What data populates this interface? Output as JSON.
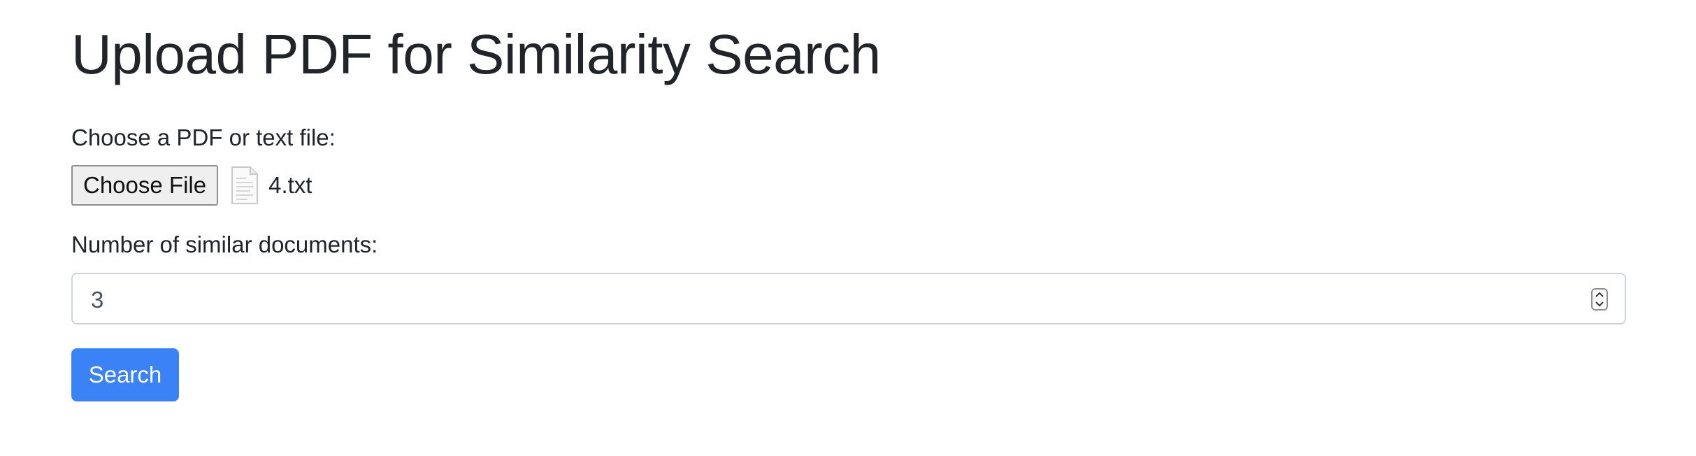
{
  "page": {
    "title": "Upload PDF for Similarity Search"
  },
  "upload": {
    "label": "Choose a PDF or text file:",
    "choose_button_label": "Choose File",
    "file_icon": "document-icon",
    "selected_file_name": "4.txt"
  },
  "count": {
    "label": "Number of similar documents:",
    "value": "3",
    "spinner_icon": "spinner-up-down-icon"
  },
  "search": {
    "button_label": "Search"
  },
  "colors": {
    "accent": "#3b82f6",
    "text": "#212529",
    "input_border": "#ced4da"
  }
}
